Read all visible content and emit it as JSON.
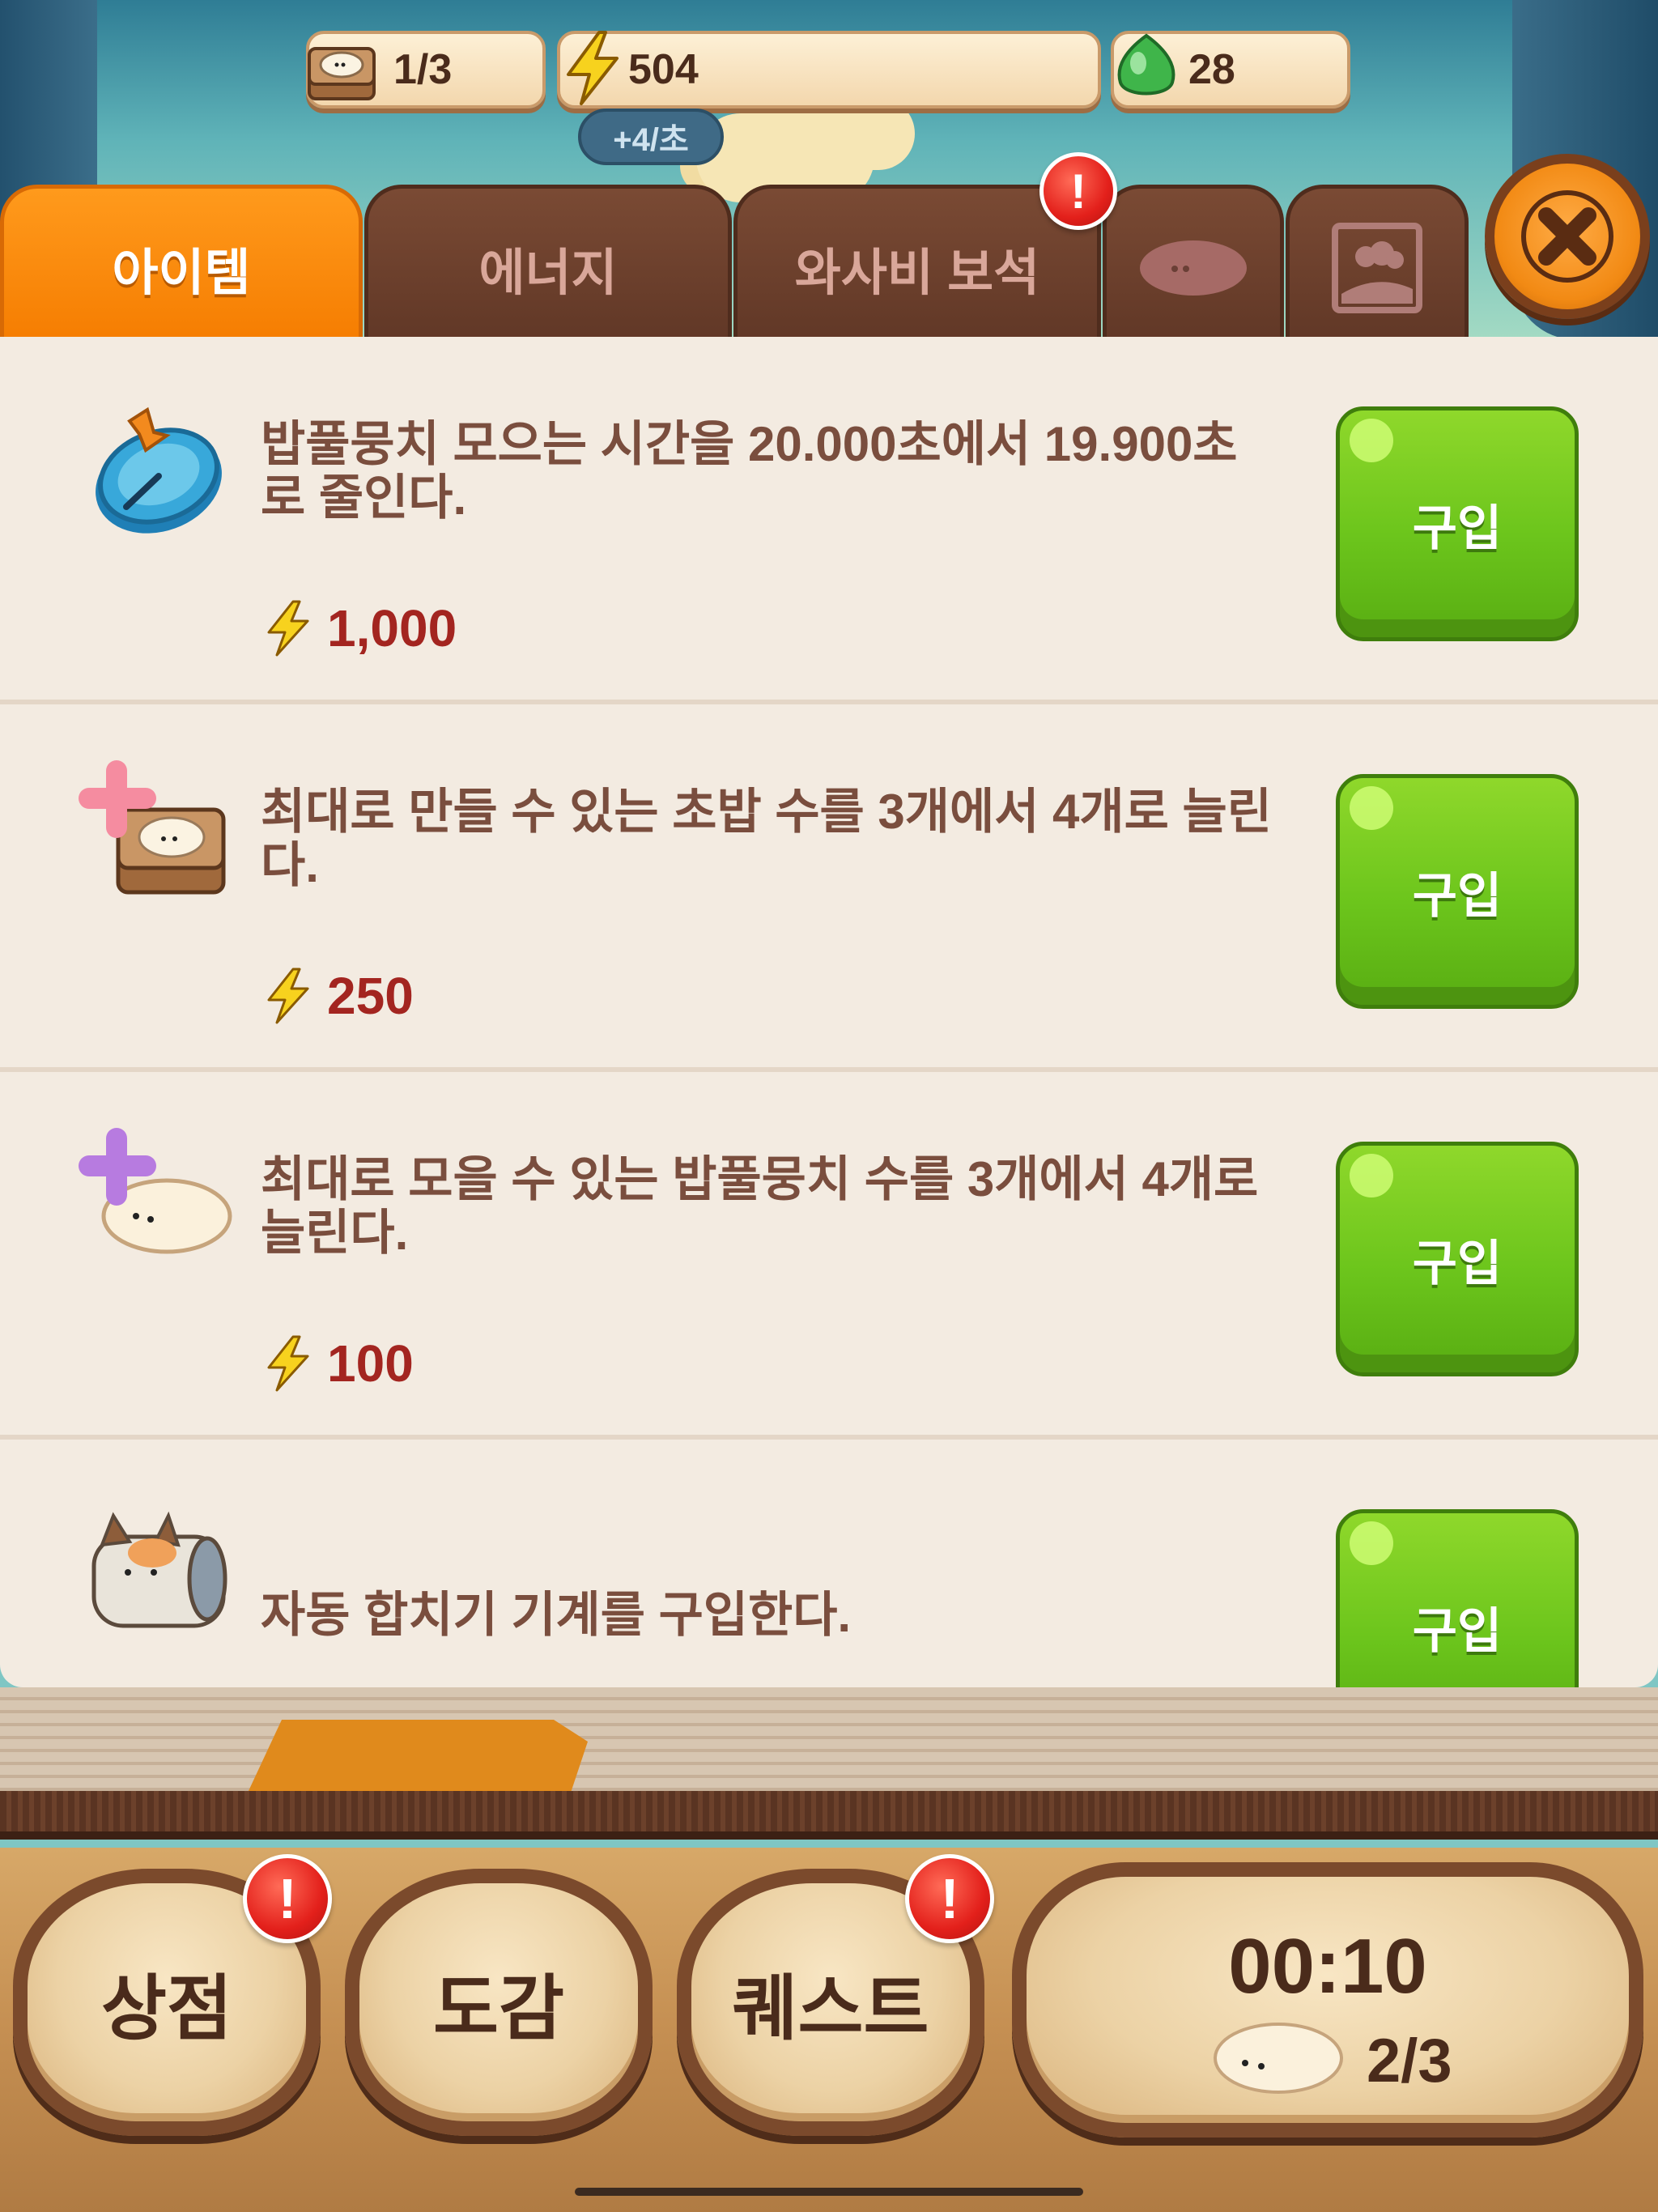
{
  "header": {
    "sushi_count": "1/3",
    "energy": "504",
    "energy_rate": "+4/초",
    "gems": "28"
  },
  "tabs": [
    {
      "label": "아이템",
      "active": true
    },
    {
      "label": "에너지",
      "active": false
    },
    {
      "label": "와사비 보석",
      "active": false,
      "alert": "!"
    },
    {
      "label": "",
      "icon": "rice-fluff-icon"
    },
    {
      "label": "",
      "icon": "background-picture-icon"
    }
  ],
  "items": [
    {
      "icon": "compass-clock-icon",
      "description": "밥풀뭉치 모으는 시간을 20.000초에서 19.900초로 줄인다.",
      "price": "1,000",
      "buy_label": "구입"
    },
    {
      "icon": "plus-sushi-board-icon",
      "description": "최대로 만들 수 있는 초밥 수를 3개에서 4개로 늘린다.",
      "price": "250",
      "buy_label": "구입"
    },
    {
      "icon": "plus-rice-fluff-icon",
      "description": "최대로 모을 수 있는 밥풀뭉치 수를 3개에서 4개로 늘린다.",
      "price": "100",
      "buy_label": "구입"
    },
    {
      "icon": "auto-merge-cat-machine-icon",
      "description": "자동 합치기 기계를 구입한다.",
      "price": "",
      "buy_label": "구입"
    }
  ],
  "bottom_nav": {
    "shop": "상점",
    "dictionary": "도감",
    "quest": "퀘스트",
    "alert": "!",
    "timer": "00:10",
    "fluff_count": "2/3"
  },
  "colors": {
    "tab_active": "#f57c00",
    "tab_inactive": "#6a3f2c",
    "buy_button": "#6cc51c",
    "price_text": "#a32520",
    "desc_text": "#7a4e3e"
  }
}
